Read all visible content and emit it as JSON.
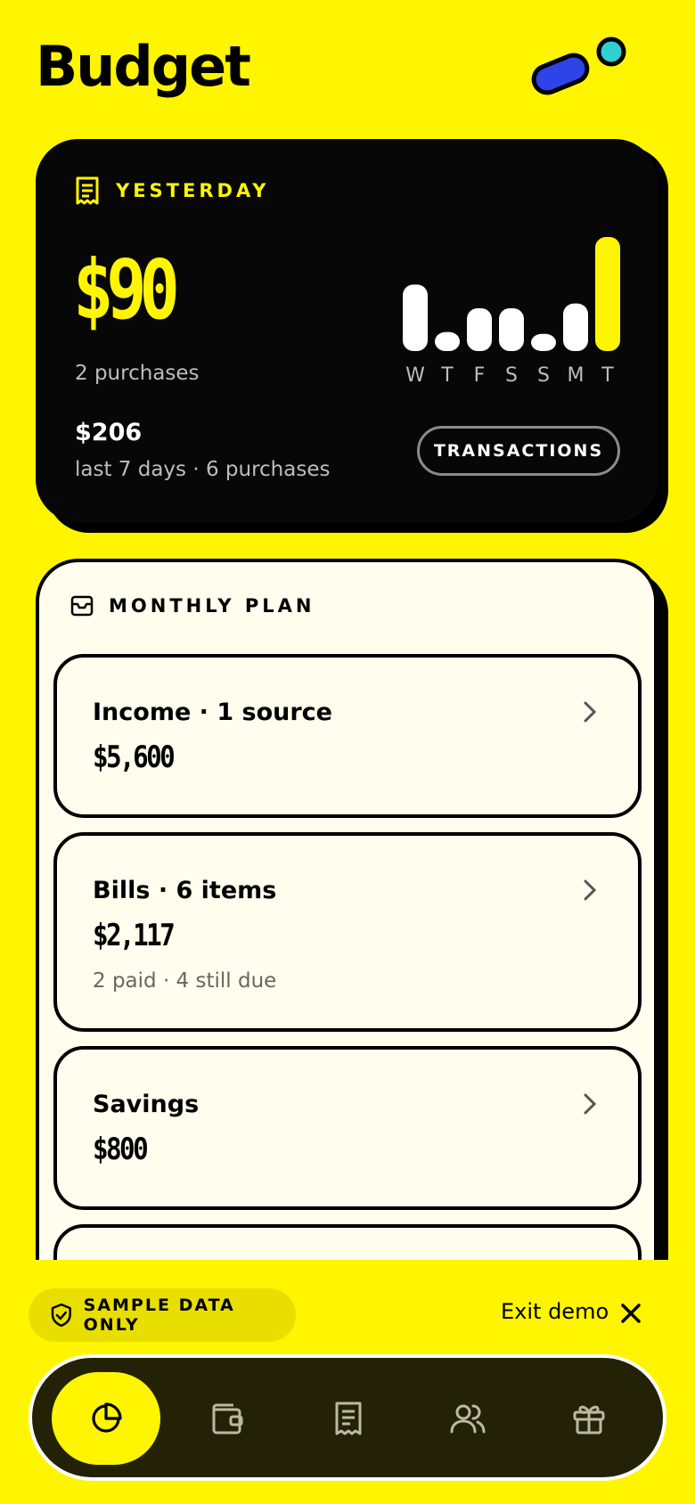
{
  "header": {
    "title": "Budget"
  },
  "yesterday": {
    "label": "YESTERDAY",
    "amount": "$90",
    "purchases": "2 purchases",
    "week_amount": "$206",
    "week_sub": "last 7 days · 6 purchases",
    "transactions_button": "TRANSACTIONS",
    "accent_color": "#FFF500"
  },
  "chart_data": {
    "type": "bar",
    "categories": [
      "W",
      "T",
      "F",
      "S",
      "S",
      "M",
      "T"
    ],
    "values": [
      70,
      20,
      45,
      45,
      18,
      50,
      120
    ],
    "highlight_index": 6
  },
  "plan": {
    "label": "MONTHLY PLAN",
    "rows": [
      {
        "title": "Income · 1 source",
        "amount": "$5,600",
        "sub": ""
      },
      {
        "title": "Bills · 6 items",
        "amount": "$2,117",
        "sub": "2 paid · 4 still due"
      },
      {
        "title": "Savings",
        "amount": "$800",
        "sub": ""
      }
    ]
  },
  "footer": {
    "sample_label": "SAMPLE DATA ONLY",
    "exit_label": "Exit demo"
  },
  "nav": {
    "items": [
      "pie-chart-icon",
      "wallet-icon",
      "receipt-icon",
      "users-icon",
      "gift-icon"
    ],
    "active_index": 0
  }
}
